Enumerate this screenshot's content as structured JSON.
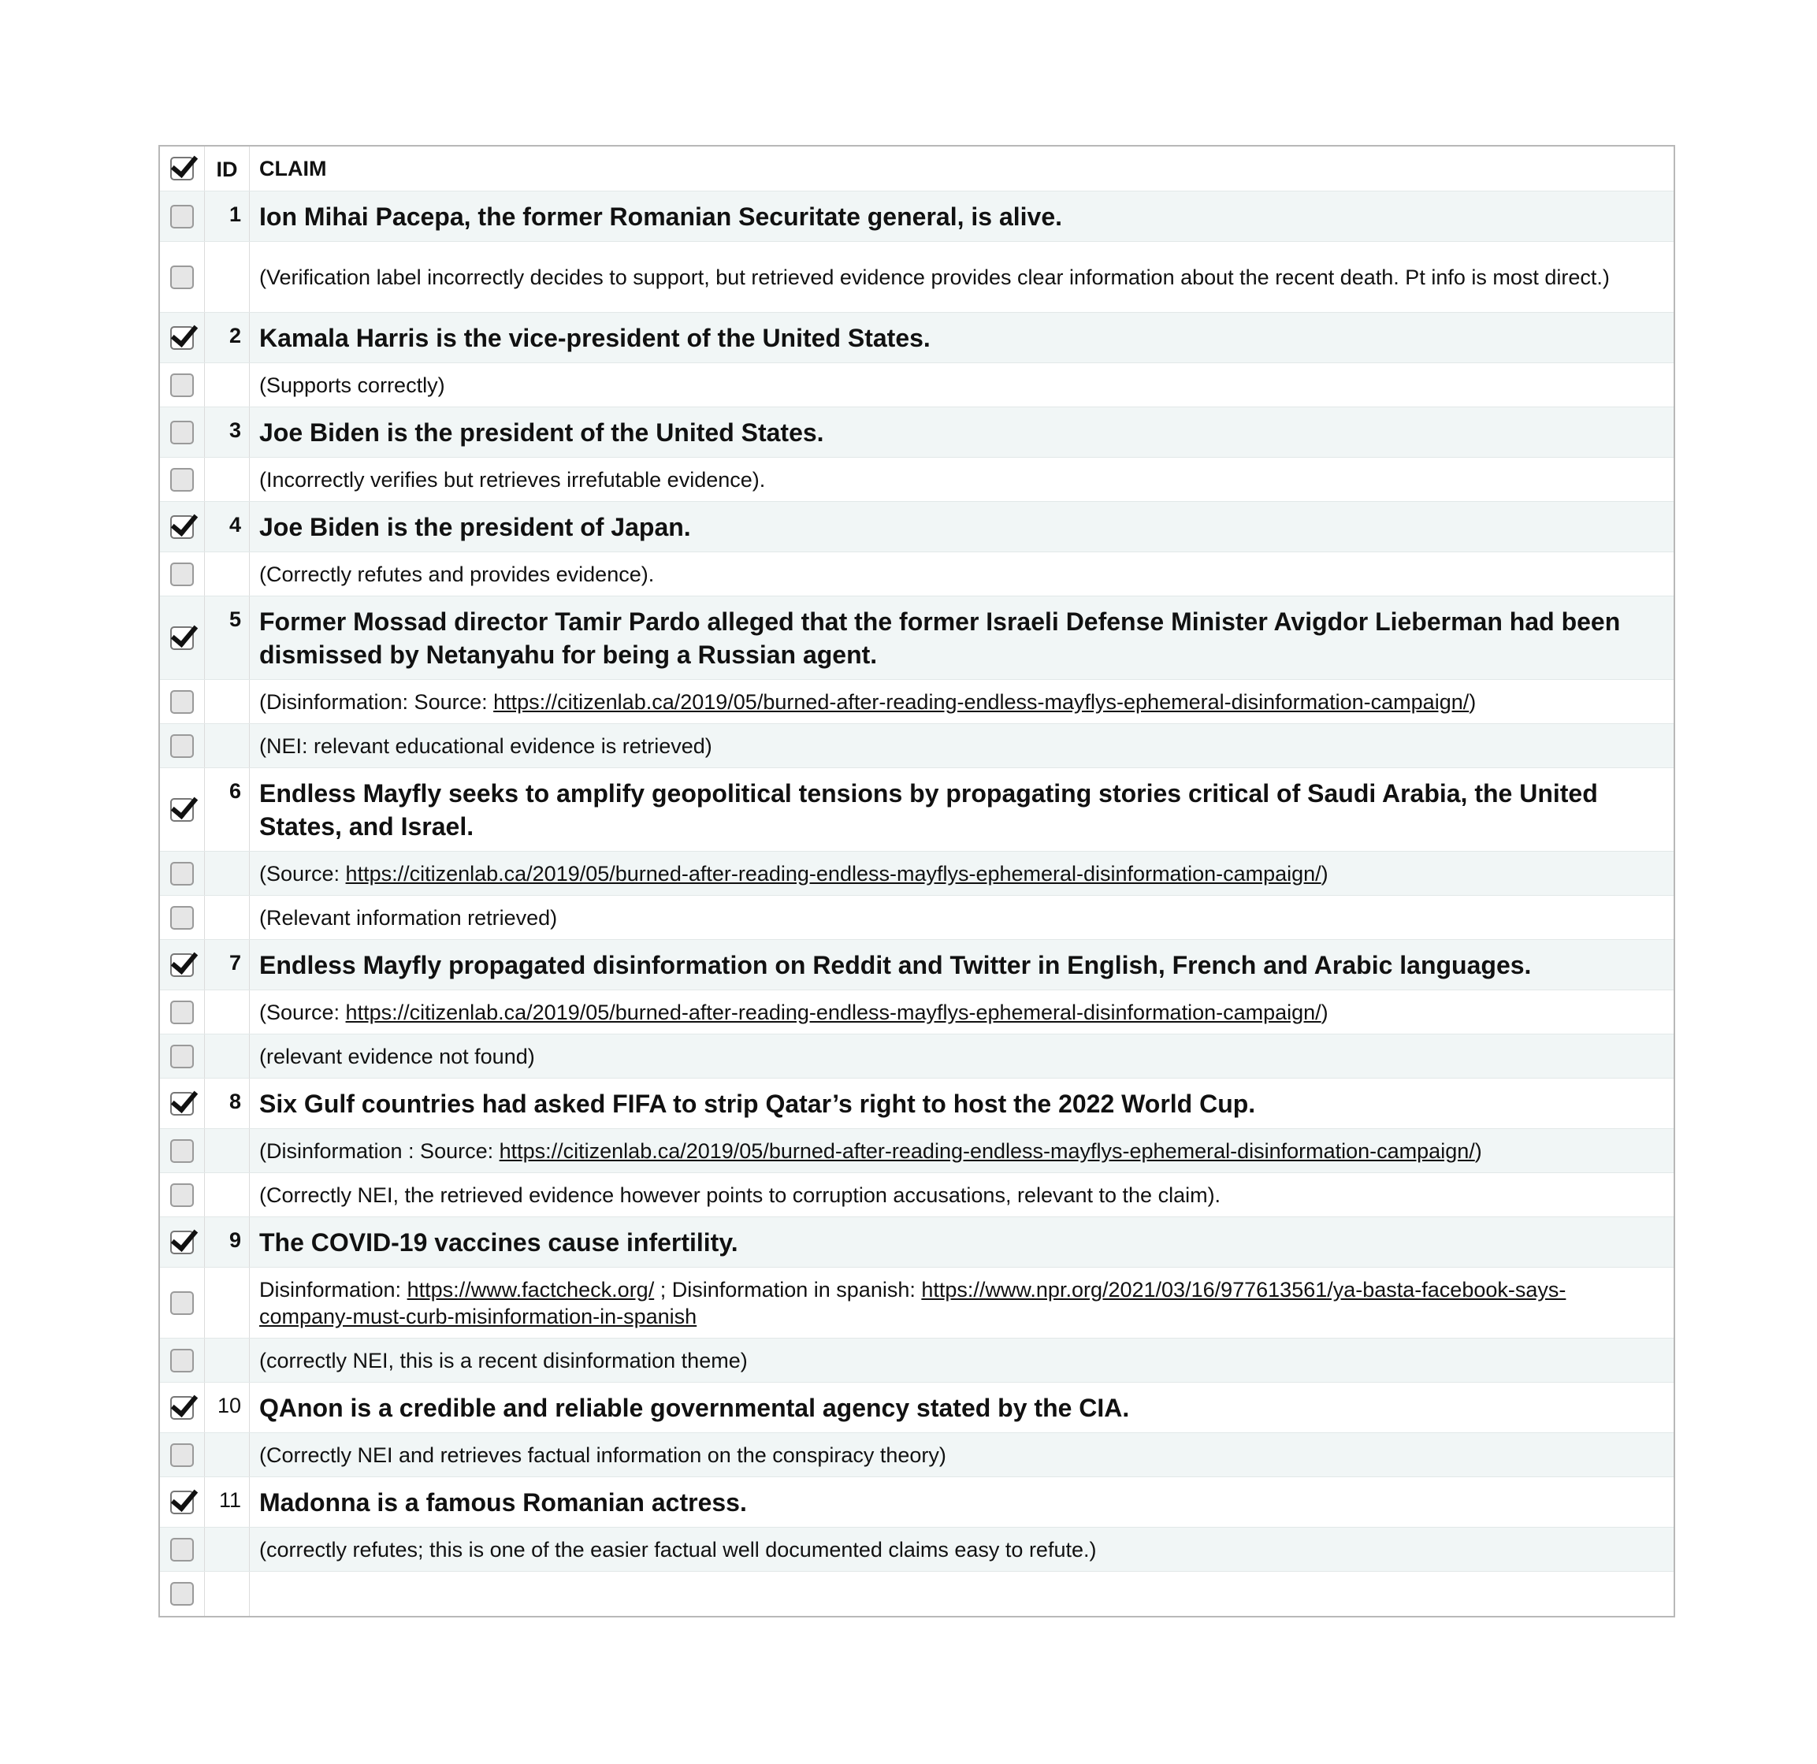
{
  "header": {
    "id_label": "ID",
    "claim_label": "CLAIM",
    "checked": true
  },
  "rows": [
    {
      "kind": "claim",
      "id": "1",
      "checked": false,
      "text": "Ion Mihai Pacepa, the former Romanian Securitate general, is alive.",
      "h": 64,
      "shade": true
    },
    {
      "kind": "note",
      "checked": false,
      "parts": [
        {
          "t": "(Verification label incorrectly decides to support, but retrieved evidence provides clear information about the recent death. Pt info is most direct.)"
        }
      ],
      "h": 90,
      "shade": false
    },
    {
      "kind": "claim",
      "id": "2",
      "checked": true,
      "text": "Kamala Harris is the vice-president of the United States.",
      "h": 64,
      "shade": true
    },
    {
      "kind": "note",
      "checked": false,
      "parts": [
        {
          "t": "(Supports correctly)"
        }
      ],
      "h": 56,
      "shade": false
    },
    {
      "kind": "claim",
      "id": "3",
      "checked": false,
      "text": "Joe Biden is the president of the United States.",
      "h": 64,
      "shade": true
    },
    {
      "kind": "note",
      "checked": false,
      "parts": [
        {
          "t": "(Incorrectly verifies but retrieves irrefutable evidence)."
        }
      ],
      "h": 56,
      "shade": false
    },
    {
      "kind": "claim",
      "id": "4",
      "checked": true,
      "text": "Joe Biden is the president of Japan.",
      "h": 64,
      "shade": true
    },
    {
      "kind": "note",
      "checked": false,
      "parts": [
        {
          "t": "(Correctly refutes and provides evidence)."
        }
      ],
      "h": 56,
      "shade": false
    },
    {
      "kind": "claim",
      "id": "5",
      "checked": true,
      "text": "Former Mossad director Tamir Pardo alleged that the former Israeli Defense Minister Avigdor Lieberman had been dismissed by Netanyahu for being a Russian agent.",
      "h": 106,
      "shade": true
    },
    {
      "kind": "note",
      "checked": false,
      "parts": [
        {
          "t": "(Disinformation: Source: "
        },
        {
          "t": "https://citizenlab.ca/2019/05/burned-after-reading-endless-mayflys-ephemeral-disinformation-campaign/",
          "link": true
        },
        {
          "t": ")"
        }
      ],
      "h": 56,
      "shade": false
    },
    {
      "kind": "note",
      "checked": false,
      "parts": [
        {
          "t": "(NEI: relevant educational evidence is retrieved)"
        }
      ],
      "h": 56,
      "shade": true
    },
    {
      "kind": "claim",
      "id": "6",
      "checked": true,
      "text": "Endless Mayfly seeks to amplify geopolitical tensions by propagating stories critical of Saudi Arabia, the United States, and Israel.",
      "h": 106,
      "shade": false
    },
    {
      "kind": "note",
      "checked": false,
      "parts": [
        {
          "t": "(Source: "
        },
        {
          "t": "https://citizenlab.ca/2019/05/burned-after-reading-endless-mayflys-ephemeral-disinformation-campaign/",
          "link": true
        },
        {
          "t": ")"
        }
      ],
      "h": 56,
      "shade": true
    },
    {
      "kind": "note",
      "checked": false,
      "parts": [
        {
          "t": "(Relevant information retrieved)"
        }
      ],
      "h": 56,
      "shade": false
    },
    {
      "kind": "claim",
      "id": "7",
      "checked": true,
      "text": "Endless Mayfly propagated disinformation on Reddit and Twitter in English, French and Arabic languages.",
      "h": 64,
      "shade": true
    },
    {
      "kind": "note",
      "checked": false,
      "parts": [
        {
          "t": "(Source: "
        },
        {
          "t": "https://citizenlab.ca/2019/05/burned-after-reading-endless-mayflys-ephemeral-disinformation-campaign/",
          "link": true
        },
        {
          "t": ")"
        }
      ],
      "h": 56,
      "shade": false
    },
    {
      "kind": "note",
      "checked": false,
      "parts": [
        {
          "t": "(relevant evidence not found)"
        }
      ],
      "h": 56,
      "shade": true
    },
    {
      "kind": "claim",
      "id": "8",
      "checked": true,
      "text": "Six Gulf countries had asked FIFA to strip Qatar’s right to host the 2022 World Cup.",
      "h": 64,
      "shade": false
    },
    {
      "kind": "note",
      "checked": false,
      "parts": [
        {
          "t": "(Disinformation : Source: "
        },
        {
          "t": "https://citizenlab.ca/2019/05/burned-after-reading-endless-mayflys-ephemeral-disinformation-campaign/",
          "link": true
        },
        {
          "t": ")"
        }
      ],
      "h": 56,
      "shade": true
    },
    {
      "kind": "note",
      "checked": false,
      "parts": [
        {
          "t": "(Correctly NEI, the retrieved evidence however points to corruption accusations, relevant to the claim)."
        }
      ],
      "h": 56,
      "shade": false
    },
    {
      "kind": "claim",
      "id": "9",
      "checked": true,
      "text": "The COVID-19 vaccines cause infertility.",
      "h": 64,
      "shade": true
    },
    {
      "kind": "note",
      "checked": false,
      "parts": [
        {
          "t": "Disinformation: "
        },
        {
          "t": "https://www.factcheck.org/",
          "link": true
        },
        {
          "t": " ; Disinformation in spanish: "
        },
        {
          "t": "https://www.npr.org/2021/03/16/977613561/ya-basta-facebook-says-company-must-curb-misinformation-in-spanish",
          "link": true
        }
      ],
      "h": 90,
      "shade": false
    },
    {
      "kind": "note",
      "checked": false,
      "parts": [
        {
          "t": "(correctly NEI, this is a recent disinformation theme)"
        }
      ],
      "h": 56,
      "shade": true
    },
    {
      "kind": "claim",
      "id": "10",
      "checked": true,
      "text": "QAnon is a credible and reliable governmental agency stated by the CIA.",
      "h": 64,
      "shade": false,
      "id_normal": true
    },
    {
      "kind": "note",
      "checked": false,
      "parts": [
        {
          "t": "(Correctly NEI and retrieves factual information on the conspiracy theory)"
        }
      ],
      "h": 56,
      "shade": true
    },
    {
      "kind": "claim",
      "id": "11",
      "checked": true,
      "text": "Madonna is a famous Romanian actress.",
      "h": 64,
      "shade": false,
      "id_normal": true
    },
    {
      "kind": "note",
      "checked": false,
      "parts": [
        {
          "t": "(correctly refutes; this is one of the easier factual well documented claims easy to refute.)"
        }
      ],
      "h": 56,
      "shade": true
    },
    {
      "kind": "note",
      "checked": false,
      "parts": [],
      "h": 56,
      "shade": false
    }
  ]
}
